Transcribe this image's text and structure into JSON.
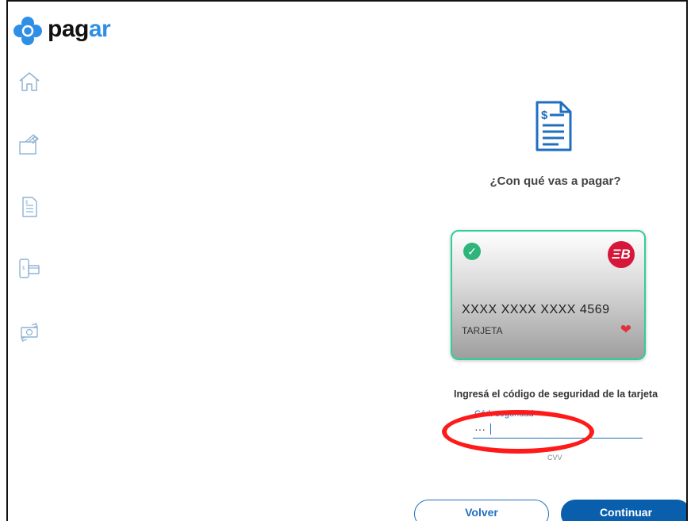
{
  "brand": {
    "name_part1": "pag",
    "name_part2": "ar",
    "color": "#2f8fe6"
  },
  "sidebar": {
    "items": [
      {
        "name": "home-icon"
      },
      {
        "name": "wallet-icon"
      },
      {
        "name": "invoice-icon"
      },
      {
        "name": "phone-card-icon"
      },
      {
        "name": "money-exchange-icon"
      }
    ]
  },
  "main": {
    "icon": "invoice-icon",
    "question": "¿Con qué vas a pagar?"
  },
  "card": {
    "selected": true,
    "brand_badge": "ΞB",
    "number": "XXXX XXXX XXXX 4569",
    "type_label": "TARJETA",
    "favorite": true,
    "border_color": "#2fcf96"
  },
  "security": {
    "prompt": "Ingresá el código de seguridad de la tarjeta",
    "field_label": "Cód. seguridad",
    "value": "···",
    "hint": "CVV",
    "highlight_color": "#ff1a1a"
  },
  "buttons": {
    "back_label": "Volver",
    "continue_label": "Continuar"
  }
}
